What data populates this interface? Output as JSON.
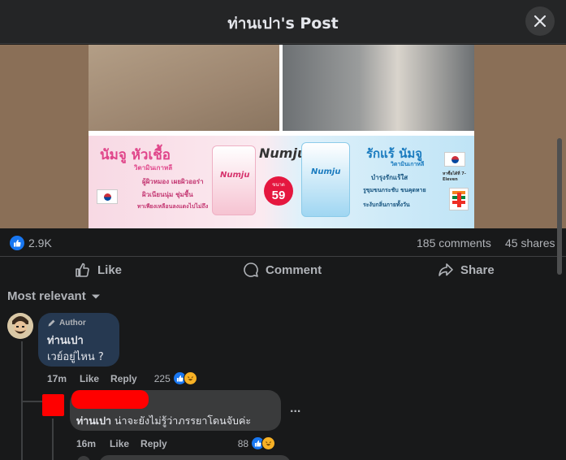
{
  "header": {
    "title": "ท่านเปา's Post"
  },
  "ad": {
    "left_title": "นัมจู หัวเชื้อ",
    "left_sub": "วิตามินเกาหลี",
    "left_lines": [
      "ผู้ผิวหมอง เผยผิวออร่า",
      "ผิวเนียนนุ่ม ชุ่มชื้น",
      "ทาเพียงเหลือนลงแดงไปไม่ถึง"
    ],
    "brand": "Numju",
    "price_label": "ขนาด",
    "price": "59",
    "right_title": "รักแร้ นัมจู",
    "right_sub": "วิตามินเกาหลี",
    "right_lines": [
      "บำรุงรักแร้ใส",
      "รูขุมขนกระชับ ขนคุดหาย",
      "ระงับกลิ่นกายทั้งวัน"
    ],
    "store_note": "หาซื้อได้ที่ 7-Eleven",
    "pack_label": "Numju"
  },
  "stats": {
    "likes": "2.9K",
    "comments": "185 comments",
    "shares": "45 shares"
  },
  "actions": {
    "like": "Like",
    "comment": "Comment",
    "share": "Share"
  },
  "sort": {
    "label": "Most relevant"
  },
  "comments": [
    {
      "badge": "Author",
      "name": "ท่านเปา",
      "text": "เวย์อยู่ไหน ?",
      "time": "17m",
      "like": "Like",
      "reply": "Reply",
      "reactions": "225"
    },
    {
      "name": "ท่านเปา",
      "text": "น่าจะยังไม่รู้ว่าภรรยาโดนจับค่ะ",
      "time": "16m",
      "like": "Like",
      "reply": "Reply",
      "reactions": "88",
      "more": "..."
    }
  ],
  "colors": {
    "accent": "#1877f2",
    "redaction": "#ff0000",
    "background": "#18191a"
  }
}
